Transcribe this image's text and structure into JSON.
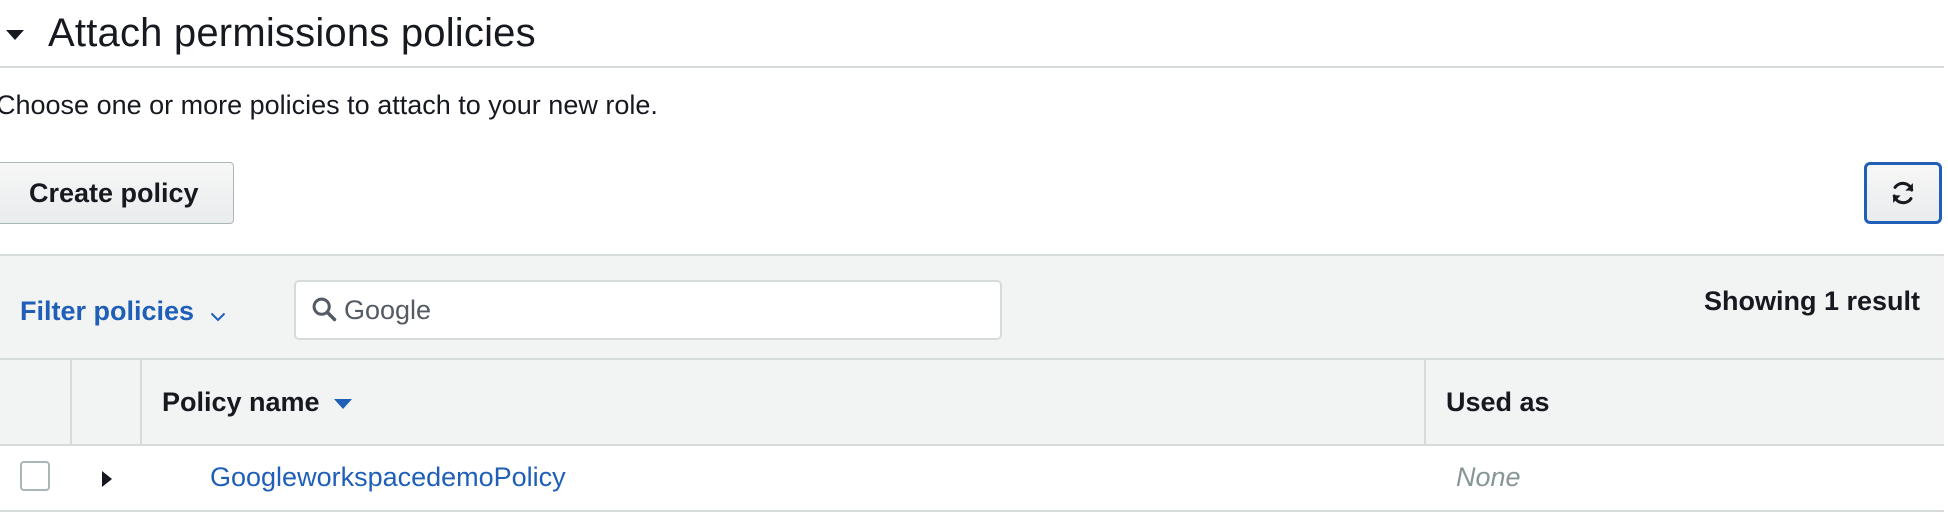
{
  "section": {
    "title": "Attach permissions policies",
    "description": "Choose one or more policies to attach to your new role."
  },
  "toolbar": {
    "create_policy_label": "Create policy",
    "refresh_icon": "refresh-icon"
  },
  "filter": {
    "dropdown_label": "Filter policies",
    "search_value": "Google",
    "result_count": "Showing 1 result"
  },
  "table": {
    "columns": [
      {
        "label": ""
      },
      {
        "label": ""
      },
      {
        "label": "Policy name",
        "sorted": "descending"
      },
      {
        "label": "Used as"
      }
    ],
    "rows": [
      {
        "policy_name": "GoogleworkspacedemoPolicy",
        "used_as": "None",
        "checked": false
      }
    ]
  },
  "colors": {
    "link": "#1f5fb8",
    "border": "#d5dbdb",
    "header_bg": "#f2f3f3",
    "muted": "#879596"
  }
}
